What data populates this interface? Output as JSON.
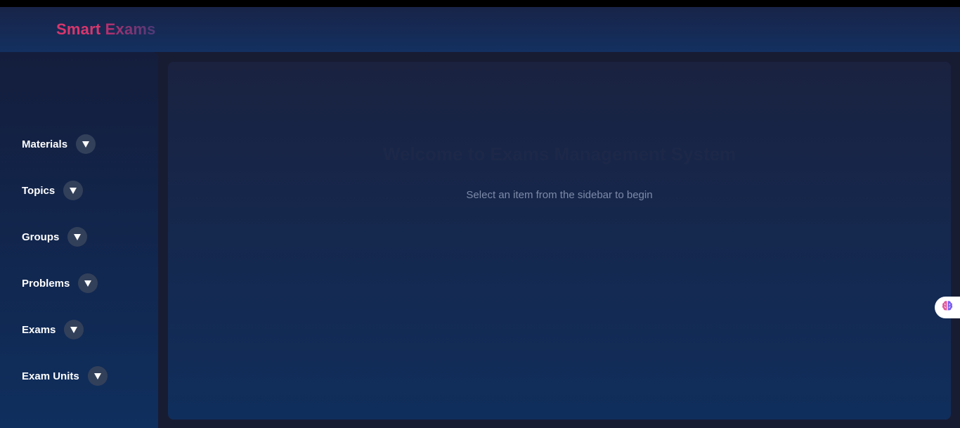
{
  "header": {
    "brand_part1": "Smart",
    "brand_part2": "Exams"
  },
  "sidebar": {
    "items": [
      {
        "label": "Materials",
        "icon": "chevron-down-icon"
      },
      {
        "label": "Topics",
        "icon": "chevron-down-icon"
      },
      {
        "label": "Groups",
        "icon": "chevron-down-icon"
      },
      {
        "label": "Problems",
        "icon": "chevron-down-icon"
      },
      {
        "label": "Exams",
        "icon": "chevron-down-icon"
      },
      {
        "label": "Exam Units",
        "icon": "chevron-down-icon"
      }
    ]
  },
  "main": {
    "title": "Welcome to Exams Management System",
    "subtitle": "Select an item from the sidebar to begin"
  },
  "assistant": {
    "icon": "brain-icon"
  },
  "colors": {
    "brand_accent": "#d9366c",
    "header_bg": "#133060",
    "sidebar_bg": "#0f2f5e",
    "page_bg": "#181c33",
    "chevron_circle": "#33405a"
  }
}
